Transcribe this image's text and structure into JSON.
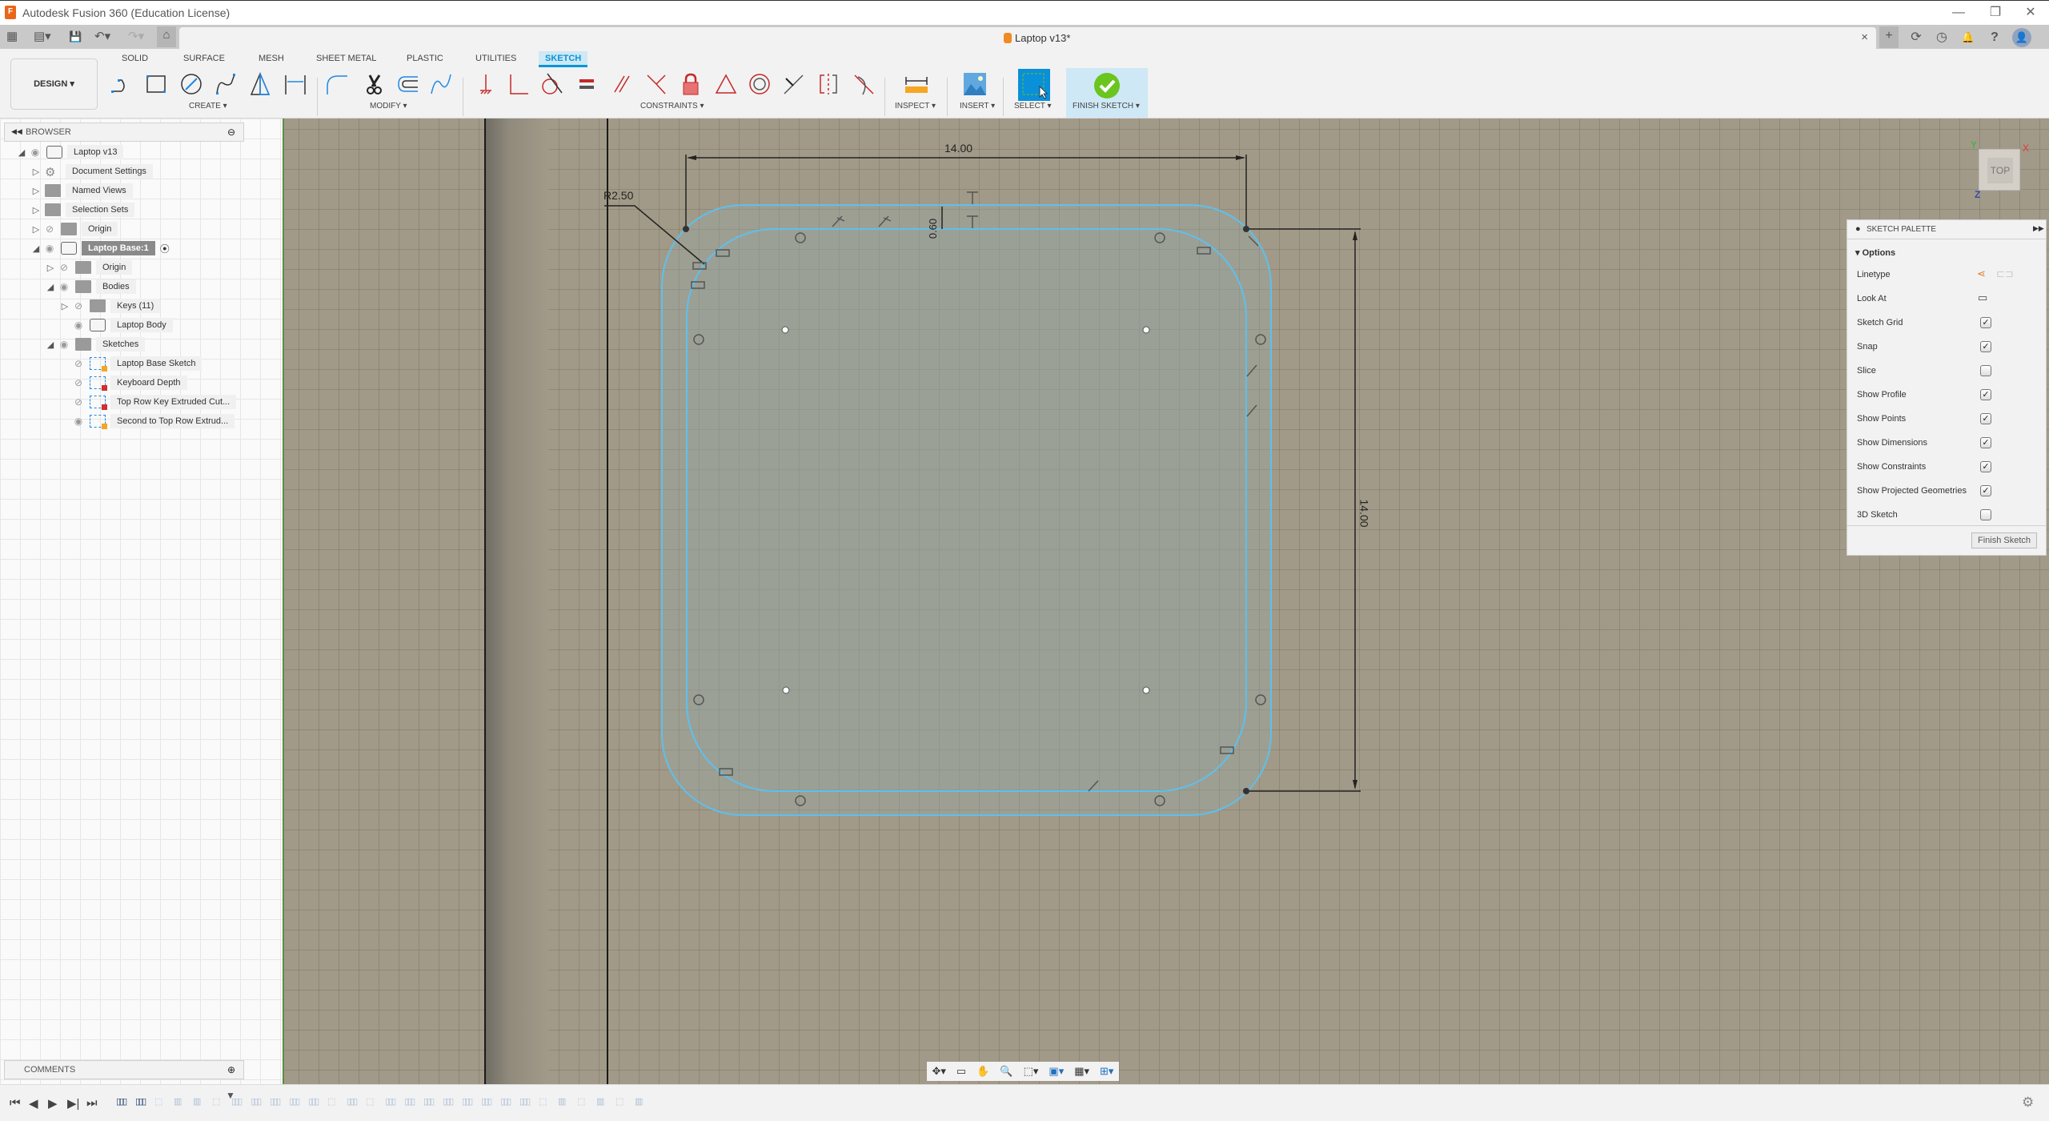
{
  "app_title": "Autodesk Fusion 360 (Education License)",
  "app_logo": "F",
  "document": {
    "name": "Laptop v13*",
    "close_label": "×"
  },
  "window_controls": {
    "minimize": "—",
    "restore": "❐",
    "close": "✕"
  },
  "quick_access": {
    "grid": "▦",
    "file": "▤▾",
    "save": "💾",
    "undo": "↶▾",
    "redo": "↷▾",
    "home": "⌂"
  },
  "right_tools": {
    "new_tab": "+",
    "extensions": "⟳",
    "jobs": "◷",
    "notifications": "🔔",
    "help": "?",
    "profile": "👤"
  },
  "workspace": {
    "label": "DESIGN ▾"
  },
  "tabs": [
    "SOLID",
    "SURFACE",
    "MESH",
    "SHEET METAL",
    "PLASTIC",
    "UTILITIES",
    "SKETCH"
  ],
  "active_tab": "SKETCH",
  "groups": {
    "create": "CREATE ▾",
    "modify": "MODIFY ▾",
    "constraints": "CONSTRAINTS ▾",
    "inspect": "INSPECT ▾",
    "insert": "INSERT ▾",
    "select": "SELECT ▾",
    "finish": "FINISH SKETCH ▾"
  },
  "browser": {
    "title": "BROWSER",
    "items": [
      {
        "label": "Laptop v13",
        "level": 0,
        "expander": "expanded",
        "visible": true,
        "icon": "component"
      },
      {
        "label": "Document Settings",
        "level": 1,
        "expander": "collapsed",
        "visible": null,
        "icon": "gear"
      },
      {
        "label": "Named Views",
        "level": 1,
        "expander": "collapsed",
        "visible": null,
        "icon": "folder"
      },
      {
        "label": "Selection Sets",
        "level": 1,
        "expander": "collapsed",
        "visible": null,
        "icon": "folder"
      },
      {
        "label": "Origin",
        "level": 1,
        "expander": "collapsed",
        "visible": false,
        "icon": "folder"
      },
      {
        "label": "Laptop Base:1",
        "level": 1,
        "expander": "expanded",
        "visible": true,
        "icon": "component",
        "selected": true,
        "active": true
      },
      {
        "label": "Origin",
        "level": 2,
        "expander": "collapsed",
        "visible": false,
        "icon": "folder"
      },
      {
        "label": "Bodies",
        "level": 2,
        "expander": "expanded",
        "visible": true,
        "icon": "folder"
      },
      {
        "label": "Keys (11)",
        "level": 3,
        "expander": "collapsed",
        "visible": false,
        "icon": "folder"
      },
      {
        "label": "Laptop Body",
        "level": 3,
        "expander": "none",
        "visible": true,
        "icon": "body"
      },
      {
        "label": "Sketches",
        "level": 2,
        "expander": "expanded",
        "visible": true,
        "icon": "folder"
      },
      {
        "label": "Laptop Base Sketch",
        "level": 3,
        "expander": "none",
        "visible": false,
        "icon": "sketch-edit"
      },
      {
        "label": "Keyboard Depth",
        "level": 3,
        "expander": "none",
        "visible": false,
        "icon": "sketch-locked"
      },
      {
        "label": "Top Row Key Extruded Cut...",
        "level": 3,
        "expander": "none",
        "visible": false,
        "icon": "sketch-locked"
      },
      {
        "label": "Second to Top Row Extrud...",
        "level": 3,
        "expander": "none",
        "visible": true,
        "icon": "sketch-edit"
      }
    ]
  },
  "comments": {
    "title": "COMMENTS"
  },
  "sketch": {
    "dimensions": {
      "width": "14.00",
      "height": "14.00",
      "offset": "0.60",
      "radius": "R2.50"
    },
    "viewcube": {
      "face": "TOP",
      "axis_x": "X",
      "axis_y": "Y",
      "axis_z": "Z"
    }
  },
  "sketch_palette": {
    "title": "SKETCH PALETTE",
    "section": "Options",
    "rows": [
      {
        "label": "Linetype",
        "type": "icons"
      },
      {
        "label": "Look At",
        "type": "button"
      },
      {
        "label": "Sketch Grid",
        "type": "checkbox",
        "checked": true
      },
      {
        "label": "Snap",
        "type": "checkbox",
        "checked": true
      },
      {
        "label": "Slice",
        "type": "checkbox",
        "checked": false
      },
      {
        "label": "Show Profile",
        "type": "checkbox",
        "checked": true
      },
      {
        "label": "Show Points",
        "type": "checkbox",
        "checked": true
      },
      {
        "label": "Show Dimensions",
        "type": "checkbox",
        "checked": true
      },
      {
        "label": "Show Constraints",
        "type": "checkbox",
        "checked": true
      },
      {
        "label": "Show Projected Geometries",
        "type": "checkbox",
        "checked": true
      },
      {
        "label": "3D Sketch",
        "type": "checkbox",
        "checked": false
      }
    ],
    "finish_button": "Finish Sketch"
  },
  "timeline": {
    "controls": [
      "⏮",
      "◀",
      "▶",
      "▶|",
      "⏭"
    ]
  },
  "nav_toolbar": [
    "orbit",
    "look-at",
    "pan",
    "zoom",
    "fit",
    "display-settings",
    "grid-settings",
    "viewports"
  ],
  "colors": {
    "accent": "#0696d7",
    "sketch_line": "#5ec0ec",
    "constraint_red": "#d32f2f",
    "finish_green": "#6ac51e"
  }
}
